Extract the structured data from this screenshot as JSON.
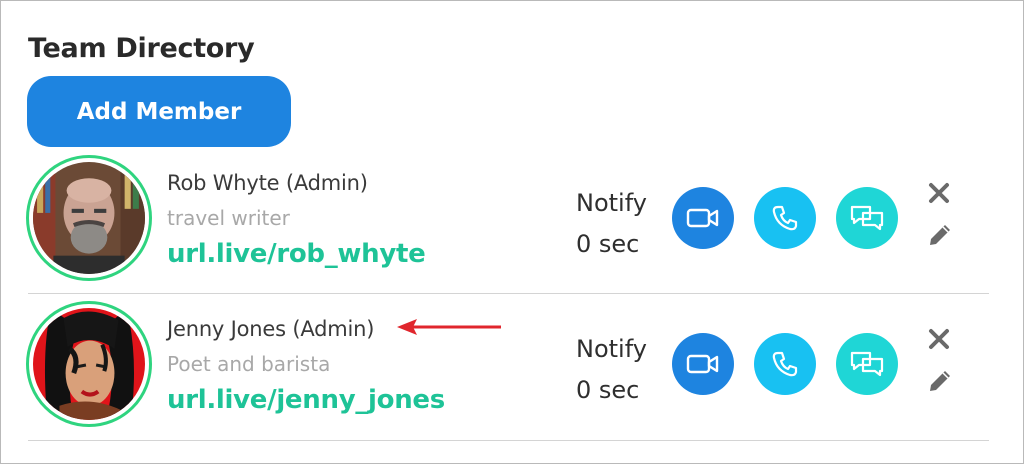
{
  "header": {
    "title": "Team Directory",
    "add_button_label": "Add Member"
  },
  "members": [
    {
      "name": "Rob Whyte (Admin)",
      "role": "travel writer",
      "url": "url.live/rob_whyte",
      "notify_label": "Notify",
      "notify_value": "0 sec"
    },
    {
      "name": "Jenny Jones (Admin)",
      "role": "Poet and barista",
      "url": "url.live/jenny_jones",
      "notify_label": "Notify",
      "notify_value": "0 sec"
    }
  ],
  "icons": [
    "video-icon",
    "phone-icon",
    "chat-icon",
    "close-icon",
    "pencil-icon"
  ],
  "colors": {
    "primary_blue": "#1e84e0",
    "phone_cyan": "#18c1f2",
    "chat_teal": "#1fd6d6",
    "link_green": "#1ec397",
    "avatar_ring": "#2fd47f",
    "annotation_arrow": "#e0262d"
  }
}
